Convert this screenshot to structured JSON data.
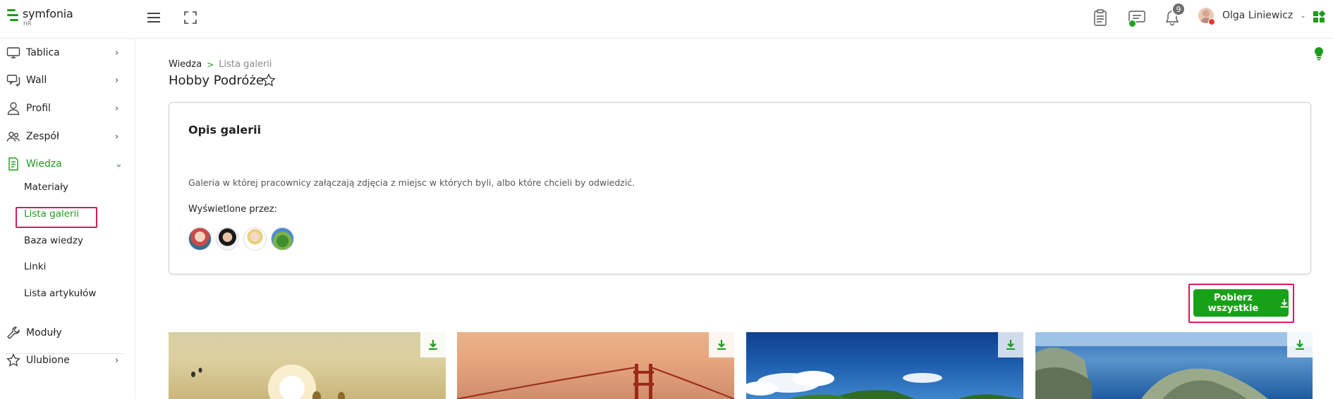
{
  "app": {
    "logo_name": "symfonia",
    "logo_sub": "HR",
    "brand_color": "#1e9b1e",
    "highlight_color": "#d81b60"
  },
  "topbar": {
    "icons": [
      "menu-icon",
      "fullscreen-icon",
      "clipboard-icon",
      "messages-icon",
      "bell-icon",
      "apps-grid-icon"
    ],
    "notifications_count": "9",
    "user_name": "Olga Liniewicz"
  },
  "sidebar": {
    "items": [
      {
        "label": "Tablica",
        "icon": "monitor-icon"
      },
      {
        "label": "Wall",
        "icon": "chat-wall-icon"
      },
      {
        "label": "Profil",
        "icon": "user-icon"
      },
      {
        "label": "Zespół",
        "icon": "team-icon"
      },
      {
        "label": "Wiedza",
        "icon": "document-icon"
      },
      {
        "label": "Moduły",
        "icon": "wrench-icon"
      },
      {
        "label": "Ulubione",
        "icon": "star-icon"
      }
    ],
    "sub_items": [
      {
        "label": "Materiały"
      },
      {
        "label": "Lista galerii"
      },
      {
        "label": "Baza wiedzy"
      },
      {
        "label": "Linki"
      },
      {
        "label": "Lista artykułów"
      }
    ]
  },
  "breadcrumb": {
    "home": "Wiedza",
    "separator": ">",
    "current": "Lista galerii"
  },
  "page": {
    "title": "Hobby Podróże"
  },
  "gallery_card": {
    "title": "Opis galerii",
    "description": "Galeria w której pracownicy załączają zdjęcia z miejsc w których byli, albo które chcieli by odwiedzić.",
    "viewed_by_label": "Wyświetlone przez:",
    "viewer_count": 4
  },
  "actions": {
    "download_all_label": "Pobierz wszystkie"
  },
  "thumbnails": [
    {
      "scene": "balloons-sunset"
    },
    {
      "scene": "golden-gate-bridge"
    },
    {
      "scene": "tropical-beach"
    },
    {
      "scene": "coastal-cliffs"
    }
  ]
}
